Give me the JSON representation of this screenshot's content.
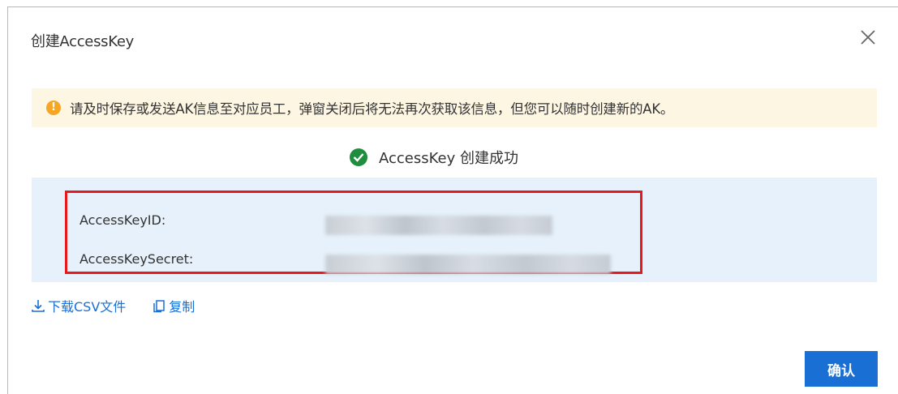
{
  "dialog": {
    "title": "创建AccessKey",
    "close_icon": "close-icon"
  },
  "notice": {
    "icon": "warning-icon",
    "text": "请及时保存或发送AK信息至对应员工，弹窗关闭后将无法再次获取该信息，但您可以随时创建新的AK。"
  },
  "success": {
    "icon": "check-circle-icon",
    "text": "AccessKey 创建成功"
  },
  "keys": {
    "id_label": "AccessKeyID:",
    "secret_label": "AccessKeySecret:"
  },
  "actions": {
    "download_label": "下载CSV文件",
    "download_icon": "download-icon",
    "copy_label": "复制",
    "copy_icon": "copy-icon"
  },
  "footer": {
    "confirm_label": "确认"
  },
  "colors": {
    "primary": "#1a6fd4",
    "warning": "#f5a623",
    "success": "#1e8e3e",
    "highlight_border": "#e8191c",
    "notice_bg": "#fdf6e3",
    "keys_bg": "#e6f1fb"
  }
}
